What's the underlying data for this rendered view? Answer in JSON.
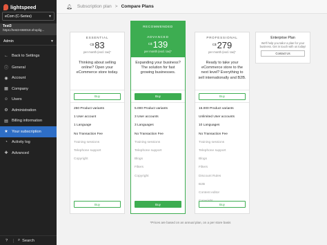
{
  "brand": {
    "name": "lightspeed"
  },
  "sidebar": {
    "store_select": "eCom (C-Series)",
    "account_name": "Test3",
    "account_url": "https://test3-668018.shoplig...",
    "admin_label": "Admin",
    "items": [
      {
        "label": "Back to Settings",
        "icon": "arrow-left-icon"
      },
      {
        "label": "General",
        "icon": "info-icon"
      },
      {
        "label": "Account",
        "icon": "user-icon"
      },
      {
        "label": "Company",
        "icon": "building-icon"
      },
      {
        "label": "Users",
        "icon": "users-icon"
      },
      {
        "label": "Administration",
        "icon": "admin-icon"
      },
      {
        "label": "Billing information",
        "icon": "billing-icon"
      },
      {
        "label": "Your subscription",
        "icon": "subscription-icon",
        "active": true
      },
      {
        "label": "Activity log",
        "icon": "activity-icon"
      },
      {
        "label": "Advanced",
        "icon": "advanced-icon"
      }
    ],
    "footer": {
      "help": "?",
      "search": "Search"
    }
  },
  "header": {
    "breadcrumb_parent": "Subscription plan",
    "breadcrumb_separator": ">",
    "breadcrumb_current": "Compare Plans"
  },
  "plans": [
    {
      "name": "ESSENTIAL",
      "currency": "C$",
      "price": "83",
      "per": "per month (excl. tax)*",
      "description": "Thinking about selling online? Open your eCommerce store today.",
      "buy_label": "Buy",
      "features": [
        {
          "label": "250 Product variants",
          "on": true
        },
        {
          "label": "1 User account",
          "on": true
        },
        {
          "label": "1 Language",
          "on": true
        },
        {
          "label": "No Transaction Fee",
          "on": true
        },
        {
          "label": "Training sessions",
          "on": false
        },
        {
          "label": "Telephone support",
          "on": false
        },
        {
          "label": "Copyright",
          "on": false
        }
      ]
    },
    {
      "recommended_label": "RECOMMENDED",
      "name": "ADVANCED",
      "currency": "C$",
      "price": "139",
      "per": "per month (excl. tax)*",
      "description": "Expanding your business? The solution for fast growing businesses.",
      "buy_label": "Buy",
      "features": [
        {
          "label": "5.000 Product variants",
          "on": true
        },
        {
          "label": "3 User accounts",
          "on": true
        },
        {
          "label": "3 Languages",
          "on": true
        },
        {
          "label": "No Transaction Fee",
          "on": true
        },
        {
          "label": "Training sessions",
          "on": false
        },
        {
          "label": "Telephone support",
          "on": false
        },
        {
          "label": "Blogs",
          "on": false
        },
        {
          "label": "Filters",
          "on": false
        },
        {
          "label": "Copyright",
          "on": false
        }
      ]
    },
    {
      "name": "PROFESSIONAL",
      "currency": "C$",
      "price": "279",
      "per": "per month (excl. tax)*",
      "description": "Ready to take your eCommerce store to the next level? Everything to sell internationally and B2B.",
      "buy_label": "Buy",
      "features": [
        {
          "label": "15.000 Product variants",
          "on": true
        },
        {
          "label": "Unlimited User accounts",
          "on": true
        },
        {
          "label": "10 Languages",
          "on": true
        },
        {
          "label": "No Transaction Fee",
          "on": true
        },
        {
          "label": "Training sessions",
          "on": false
        },
        {
          "label": "Telephone support",
          "on": false
        },
        {
          "label": "Blogs",
          "on": false
        },
        {
          "label": "Filters",
          "on": false
        },
        {
          "label": "Discount Rules",
          "on": false
        },
        {
          "label": "B2B",
          "on": false
        },
        {
          "label": "Content editor",
          "on": false
        },
        {
          "label": "Copyright",
          "on": false
        }
      ]
    }
  ],
  "enterprise": {
    "title": "Enterprise Plan",
    "text": "We'll help you tailor a plan for your business. Get in touch with us today!",
    "button": "Contact Us"
  },
  "footnote": "*Prices are based on an annual plan, on a per store basis",
  "colors": {
    "accent_green": "#3dad51",
    "active_blue": "#2e6ec6",
    "sidebar_bg": "#222222",
    "logo_red": "#e4573d"
  }
}
